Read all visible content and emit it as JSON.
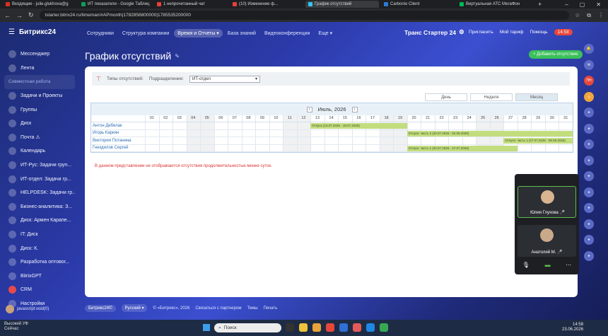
{
  "browser": {
    "tabs": [
      {
        "label": "Входящие - julie.glukhova@g",
        "color": "#d93025"
      },
      {
        "label": "ИТ показатели - Google Таблиц",
        "color": "#0f9d58"
      },
      {
        "label": "1 непрочитанный чат",
        "color": "#e4403c"
      },
      {
        "label": "(10) Изменение ф...",
        "color": "#e4403c"
      },
      {
        "label": "График отсутствий",
        "color": "#2fc6f6"
      },
      {
        "label": "Carbonio Client",
        "color": "#2b7bd6"
      },
      {
        "label": "Виртуальная АТС МегаФон",
        "color": "#00b956"
      }
    ],
    "url": "tstarter.bitrix24.ru/timeman/#APmonth|1782856800000|1785535200000"
  },
  "sidebar": {
    "brand": "Битрикс24",
    "items": [
      {
        "label": "Мессенджер",
        "icon": "message-icon",
        "section": false
      },
      {
        "label": "Лента",
        "icon": "feed-icon",
        "section": false
      },
      {
        "label": "Совместная работа",
        "icon": "",
        "section": true
      },
      {
        "label": "Задачи и Проекты",
        "icon": "tasks-icon",
        "section": false
      },
      {
        "label": "Группы",
        "icon": "groups-icon",
        "section": false
      },
      {
        "label": "Диск",
        "icon": "disk-icon",
        "section": false
      },
      {
        "label": "Почта ⚠",
        "icon": "mail-icon",
        "section": false
      },
      {
        "label": "Календарь",
        "icon": "calendar-icon",
        "section": false
      },
      {
        "label": "ИТ-Рус: Задачи груп...",
        "icon": "group-icon",
        "section": false
      },
      {
        "label": "ИТ-отдел: Задачи гр...",
        "icon": "group-icon",
        "section": false
      },
      {
        "label": "HELPDESK: Задачи гр...",
        "icon": "group-icon",
        "section": false
      },
      {
        "label": "Бизнес-аналитика: З...",
        "icon": "group-icon",
        "section": false
      },
      {
        "label": "Диск: Армен Карапе...",
        "icon": "disk-icon",
        "section": false
      },
      {
        "label": "IT: Диск",
        "icon": "disk-icon",
        "section": false
      },
      {
        "label": "Диск: К.",
        "icon": "disk-icon",
        "section": false
      },
      {
        "label": "Разработка оптовог...",
        "icon": "project-icon",
        "section": false
      },
      {
        "label": "BitrixGPT",
        "icon": "gpt-icon",
        "section": false
      },
      {
        "label": "CRM",
        "icon": "crm-icon",
        "section": false,
        "badge": true
      },
      {
        "label": "Настройки",
        "icon": "gear-icon",
        "section": false
      }
    ],
    "user": "javascript:void(0)"
  },
  "topnav": {
    "items": [
      "Сотрудники",
      "Структура компании",
      "Время и Отчеты ▾",
      "База знаний",
      "Видеоконференции",
      "Еще ▾"
    ],
    "active_index": 2,
    "company": "Транс Стартер 24",
    "invite": "Пригласить",
    "tariff": "Мой тариф",
    "help": "Помощь",
    "time": "14:58"
  },
  "page": {
    "title": "График отсутствий",
    "add_button": "+ Добавить отсутствие"
  },
  "filters": {
    "absence_types_label": "Типы отсутствий:",
    "department_label": "Подразделение:",
    "department_value": "ИТ-отдел"
  },
  "view_tabs": {
    "day": "День",
    "week": "Неделя",
    "month": "Месяц"
  },
  "calendar": {
    "month": "Июль, 2026",
    "days": [
      "01",
      "02",
      "03",
      "04",
      "05",
      "06",
      "07",
      "08",
      "09",
      "10",
      "11",
      "12",
      "13",
      "14",
      "15",
      "16",
      "17",
      "18",
      "19",
      "20",
      "21",
      "22",
      "23",
      "24",
      "25",
      "26",
      "27",
      "28",
      "29",
      "30",
      "31"
    ],
    "weekend_days": [
      4,
      5,
      11,
      12,
      18,
      19,
      25,
      26
    ],
    "employees": [
      "Антон Дебелак",
      "Игорь Каркин",
      "Виктория Потанина",
      "Гнездилов Сергей"
    ],
    "absences": [
      {
        "row": 0,
        "start": 13,
        "end": 19,
        "label": "Отпуск (13.07.2026 - 19.07.2026)"
      },
      {
        "row": 1,
        "start": 20,
        "end": 31,
        "label": "Отпуск: часть 2 (20.07.2026 - 02.08.2026)"
      },
      {
        "row": 2,
        "start": 27,
        "end": 31,
        "label": "Отпуск: часть 1 (27.07.2026 - 09.08.2026)"
      },
      {
        "row": 3,
        "start": 20,
        "end": 27,
        "label": "Отпуск: часть 1 (20.07.2026 - 27.07.2026)"
      }
    ],
    "note": "В данном представлении не отображаются отсутствия продолжительностью менее суток."
  },
  "footer": {
    "brand": "Битрикс24©",
    "language": "Русский ▾",
    "copyright": "© «Битрикс», 2026",
    "partner": "Связаться с партнером",
    "themes": "Темы",
    "print": "Печать"
  },
  "right_rail": [
    "🔔",
    "✉",
    "ПН",
    "☺",
    "●",
    "●",
    "●",
    "●",
    "●",
    "●",
    "●",
    "●",
    "●",
    "●"
  ],
  "video_call": {
    "participants": [
      {
        "name": "Юлия Глухова 🎤",
        "active": true
      },
      {
        "name": "Анатолий М. 🎤",
        "active": false
      }
    ]
  },
  "taskbar": {
    "weather_top": "Высокий УФ",
    "weather_bottom": "Сейчас",
    "search_placeholder": "Поиск",
    "time": "14:58",
    "date": "23.06.2026"
  }
}
